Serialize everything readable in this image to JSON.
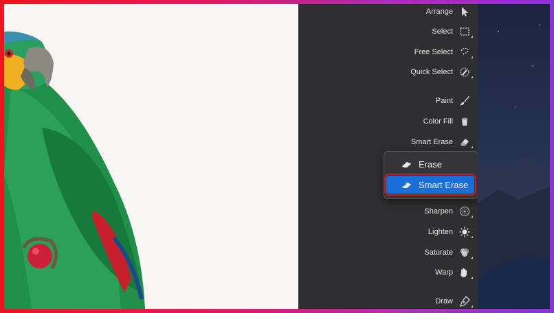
{
  "tools": [
    {
      "name": "arrange",
      "label": "Arrange",
      "icon": "arrow-cursor-icon"
    },
    {
      "name": "select",
      "label": "Select",
      "icon": "marquee-select-icon"
    },
    {
      "name": "free-select",
      "label": "Free Select",
      "icon": "lasso-icon"
    },
    {
      "name": "quick-select",
      "label": "Quick Select",
      "icon": "quick-select-brush-icon"
    },
    {
      "name": "paint",
      "label": "Paint",
      "icon": "paintbrush-icon"
    },
    {
      "name": "color-fill",
      "label": "Color Fill",
      "icon": "paint-bucket-icon"
    },
    {
      "name": "smart-erase",
      "label": "Smart Erase",
      "icon": "eraser-icon"
    },
    {
      "name": "sharpen",
      "label": "Sharpen",
      "icon": "sharpen-icon"
    },
    {
      "name": "lighten",
      "label": "Lighten",
      "icon": "sun-icon"
    },
    {
      "name": "saturate",
      "label": "Saturate",
      "icon": "saturate-icon"
    },
    {
      "name": "warp",
      "label": "Warp",
      "icon": "hand-warp-icon"
    },
    {
      "name": "draw",
      "label": "Draw",
      "icon": "pen-nib-icon"
    }
  ],
  "erase_menu": {
    "items": [
      {
        "label": "Erase",
        "icon": "eraser-icon",
        "selected": false
      },
      {
        "label": "Smart Erase",
        "icon": "smart-eraser-icon",
        "selected": true
      }
    ]
  },
  "colors": {
    "panel": "#2f2f31",
    "selection": "#1a6ed8",
    "highlight_border": "#d0182a",
    "frame_gradient": [
      "#f0141e",
      "#8a34d8"
    ]
  },
  "canvas": {
    "subject": "parrot-illustration"
  }
}
